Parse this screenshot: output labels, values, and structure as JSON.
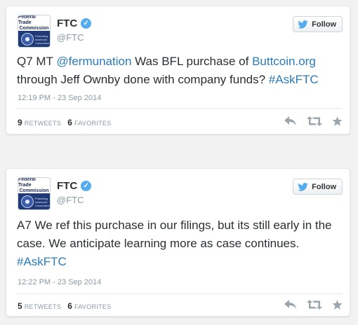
{
  "colors": {
    "link": "#2b7bb9",
    "text": "#292f33",
    "muted": "#8899a6",
    "verified": "#55acee",
    "avatar_blue": "#1f3a75"
  },
  "tweets": [
    {
      "account": {
        "name": "FTC",
        "handle": "@FTC",
        "avatar_line1": "Federal Trade",
        "avatar_line2": "Commission",
        "avatar_tagline": "Protecting America's Consumers"
      },
      "follow_label": "Follow",
      "text_parts": [
        {
          "text": "Q7 MT ",
          "link": false
        },
        {
          "text": "@fermunation",
          "link": true
        },
        {
          "text": " Was BFL purchase of ",
          "link": false
        },
        {
          "text": "Buttcoin.org",
          "link": true
        },
        {
          "text": " through Jeff Ownby done with company funds? ",
          "link": false
        },
        {
          "text": "#AskFTC",
          "link": true
        }
      ],
      "timestamp": "12:19 PM - 23 Sep 2014",
      "retweets_count": "9",
      "retweets_label": "RETWEETS",
      "favorites_count": "6",
      "favorites_label": "FAVORITES",
      "icons": [
        "reply-icon",
        "retweet-icon",
        "favorite-star-icon"
      ]
    },
    {
      "account": {
        "name": "FTC",
        "handle": "@FTC",
        "avatar_line1": "Federal Trade",
        "avatar_line2": "Commission",
        "avatar_tagline": "Protecting America's Consumers"
      },
      "follow_label": "Follow",
      "text_parts": [
        {
          "text": "A7 We ref this purchase in our filings, but its still early in the case. We anticipate learning more as case continues. ",
          "link": false
        },
        {
          "text": "#AskFTC",
          "link": true
        }
      ],
      "timestamp": "12:22 PM - 23 Sep 2014",
      "retweets_count": "5",
      "retweets_label": "RETWEETS",
      "favorites_count": "6",
      "favorites_label": "FAVORITES",
      "icons": [
        "reply-icon",
        "retweet-icon",
        "favorite-star-icon"
      ]
    }
  ]
}
